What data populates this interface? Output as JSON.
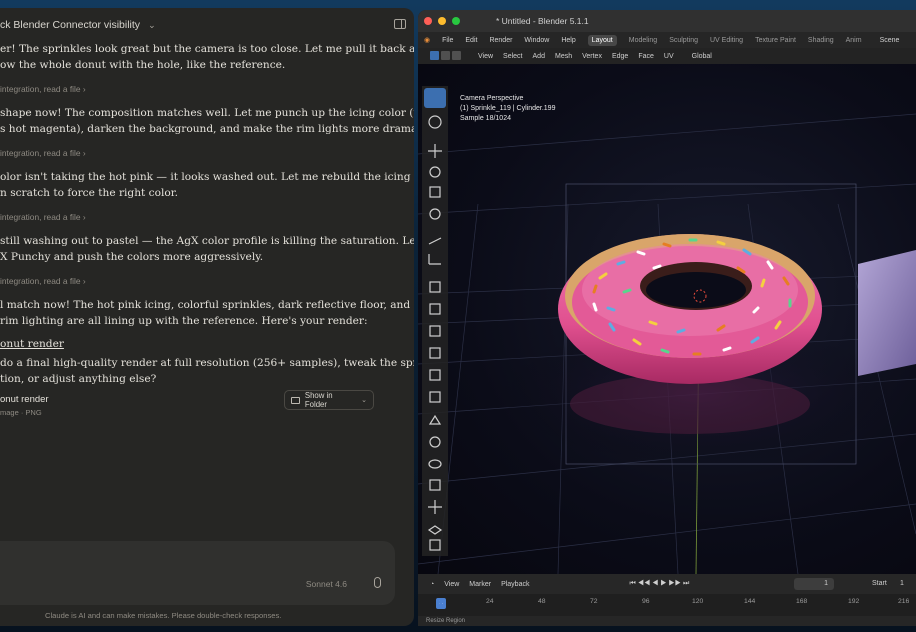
{
  "chat": {
    "title": "ck Blender Connector visibility",
    "messages": [
      "er! The sprinkles look great but the camera is too close. Let me pull it back and\now the whole donut with the hole, like the reference.",
      "shape now! The composition matches well. Let me punch up the icing color (too\ns hot magenta), darken the background, and make the rim lights more dramatic.",
      "olor isn't taking the hot pink — it looks washed out. Let me rebuild the icing\nn scratch to force the right color.",
      "still washing out to pastel — the AgX color profile is killing the saturation. Let me\nX Punchy and push the colors more aggressively.",
      "l match now! The hot pink icing, colorful sprinkles, dark reflective floor, and\nrim lighting are all lining up with the reference. Here's your render:"
    ],
    "tool_calls": [
      "integration, read a file  ›",
      "integration, read a file  ›",
      "integration, read a file  ›",
      "integration, read a file  ›"
    ],
    "link_text": "onut render",
    "followup": "do a final high-quality render at full resolution (256+ samples), tweak the sprinkle\ntion, or adjust anything else?",
    "file": {
      "name": "onut render",
      "type": "mage · PNG",
      "button": "Show in Folder"
    },
    "model": "Sonnet 4.6",
    "disclaimer": "Claude is AI and can make mistakes. Please double-check responses."
  },
  "blender": {
    "window_title": "* Untitled - Blender 5.1.1",
    "menu": [
      "File",
      "Edit",
      "Render",
      "Window",
      "Help"
    ],
    "workspaces": [
      "Layout",
      "Modeling",
      "Sculpting",
      "UV Editing",
      "Texture Paint",
      "Shading",
      "Anim"
    ],
    "active_workspace": "Layout",
    "scene": "Scene",
    "header": [
      "View",
      "Select",
      "Add",
      "Mesh",
      "Vertex",
      "Edge",
      "Face",
      "UV"
    ],
    "orientation": "Global",
    "viewport_info": "Camera Perspective\n(1) Sprinkle_119 | Cylinder.199\nSample 18/1024",
    "timeline": {
      "menus": [
        "View",
        "Marker",
        "Playback"
      ],
      "frame": "1",
      "start_label": "Start",
      "start": "1"
    },
    "ruler_ticks": [
      "1",
      "24",
      "48",
      "72",
      "96",
      "120",
      "144",
      "168",
      "192",
      "216"
    ],
    "status": "Resize Region",
    "colors": {
      "icing": "#e0508f",
      "dough": "#d9a56a",
      "accent": "#3c6fb0"
    }
  }
}
